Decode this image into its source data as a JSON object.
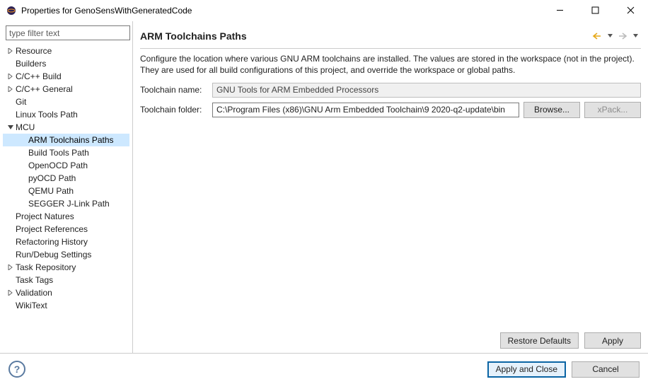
{
  "window": {
    "title": "Properties for GenoSensWithGeneratedCode"
  },
  "filter_placeholder": "type filter text",
  "tree": {
    "items": [
      {
        "label": "Resource",
        "depth": 1,
        "twisty": "right",
        "sel": false
      },
      {
        "label": "Builders",
        "depth": 1,
        "twisty": "",
        "sel": false
      },
      {
        "label": "C/C++ Build",
        "depth": 1,
        "twisty": "right",
        "sel": false
      },
      {
        "label": "C/C++ General",
        "depth": 1,
        "twisty": "right",
        "sel": false
      },
      {
        "label": "Git",
        "depth": 1,
        "twisty": "",
        "sel": false
      },
      {
        "label": "Linux Tools Path",
        "depth": 1,
        "twisty": "",
        "sel": false
      },
      {
        "label": "MCU",
        "depth": 1,
        "twisty": "down",
        "sel": false
      },
      {
        "label": "ARM Toolchains Paths",
        "depth": 2,
        "twisty": "",
        "sel": true
      },
      {
        "label": "Build Tools Path",
        "depth": 2,
        "twisty": "",
        "sel": false
      },
      {
        "label": "OpenOCD Path",
        "depth": 2,
        "twisty": "",
        "sel": false
      },
      {
        "label": "pyOCD Path",
        "depth": 2,
        "twisty": "",
        "sel": false
      },
      {
        "label": "QEMU Path",
        "depth": 2,
        "twisty": "",
        "sel": false
      },
      {
        "label": "SEGGER J-Link Path",
        "depth": 2,
        "twisty": "",
        "sel": false
      },
      {
        "label": "Project Natures",
        "depth": 1,
        "twisty": "",
        "sel": false
      },
      {
        "label": "Project References",
        "depth": 1,
        "twisty": "",
        "sel": false
      },
      {
        "label": "Refactoring History",
        "depth": 1,
        "twisty": "",
        "sel": false
      },
      {
        "label": "Run/Debug Settings",
        "depth": 1,
        "twisty": "",
        "sel": false
      },
      {
        "label": "Task Repository",
        "depth": 1,
        "twisty": "right",
        "sel": false
      },
      {
        "label": "Task Tags",
        "depth": 1,
        "twisty": "",
        "sel": false
      },
      {
        "label": "Validation",
        "depth": 1,
        "twisty": "right",
        "sel": false
      },
      {
        "label": "WikiText",
        "depth": 1,
        "twisty": "",
        "sel": false
      }
    ]
  },
  "page": {
    "heading": "ARM Toolchains Paths",
    "description": "Configure the location where various GNU ARM toolchains are installed. The values are stored in the workspace (not in the project). They are used for all build configurations of this project, and override the workspace or global paths.",
    "toolchain_name_label": "Toolchain name:",
    "toolchain_name_value": "GNU Tools for ARM Embedded Processors",
    "toolchain_folder_label": "Toolchain folder:",
    "toolchain_folder_value": "C:\\Program Files (x86)\\GNU Arm Embedded Toolchain\\9 2020-q2-update\\bin",
    "browse_label": "Browse...",
    "xpack_label": "xPack...",
    "restore_defaults_label": "Restore Defaults",
    "apply_label": "Apply"
  },
  "footer": {
    "apply_close_label": "Apply and Close",
    "cancel_label": "Cancel"
  }
}
